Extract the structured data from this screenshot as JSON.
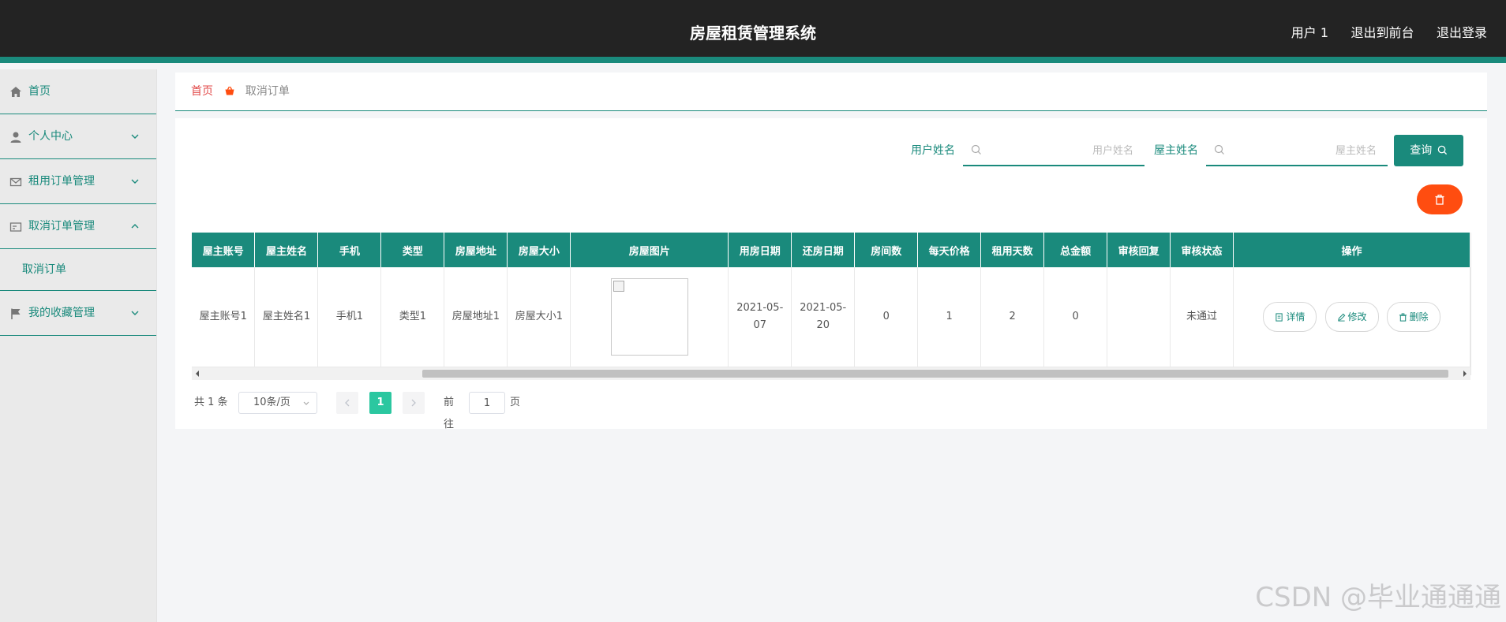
{
  "header": {
    "title": "房屋租赁管理系统",
    "links": [
      "用户 1",
      "退出到前台",
      "退出登录"
    ]
  },
  "sidebar": {
    "items": [
      {
        "label": "首页",
        "icon": "home-icon"
      },
      {
        "label": "个人中心",
        "icon": "user-icon"
      },
      {
        "label": "租用订单管理",
        "icon": "mail-icon"
      },
      {
        "label": "取消订单管理",
        "icon": "card-icon",
        "expanded": true,
        "children": [
          "取消订单"
        ]
      },
      {
        "label": "我的收藏管理",
        "icon": "flag-icon"
      }
    ]
  },
  "breadcrumb": {
    "home": "首页",
    "current": "取消订单"
  },
  "search": {
    "field1_label": "用户姓名",
    "field1_placeholder": "用户姓名",
    "field2_label": "屋主姓名",
    "field2_placeholder": "屋主姓名",
    "query_label": "查询"
  },
  "table": {
    "headers": [
      "屋主账号",
      "屋主姓名",
      "手机",
      "类型",
      "房屋地址",
      "房屋大小",
      "房屋图片",
      "用房日期",
      "还房日期",
      "房间数",
      "每天价格",
      "租用天数",
      "总金额",
      "审核回复",
      "审核状态",
      "操作"
    ],
    "rows": [
      {
        "owner_account": "屋主账号1",
        "owner_name": "屋主姓名1",
        "phone": "手机1",
        "type": "类型1",
        "address": "房屋地址1",
        "size": "房屋大小1",
        "start_date": "2021-05-07",
        "end_date": "2021-05-20",
        "rooms": "0",
        "daily_price": "1",
        "days": "2",
        "total": "0",
        "reply": "",
        "status": "未通过",
        "actions": [
          "详情",
          "修改",
          "删除"
        ]
      }
    ]
  },
  "pagination": {
    "total_text": "共 1 条",
    "page_size": "10条/页",
    "current_page": "1",
    "goto_label": "前往",
    "goto_value": "1",
    "page_unit": "页"
  },
  "watermark": "CSDN @毕业通通通",
  "colors": {
    "primary": "#1a8a7c",
    "header_bg": "#232323",
    "danger": "#ff4d10",
    "page_active": "#2bc7a0"
  }
}
